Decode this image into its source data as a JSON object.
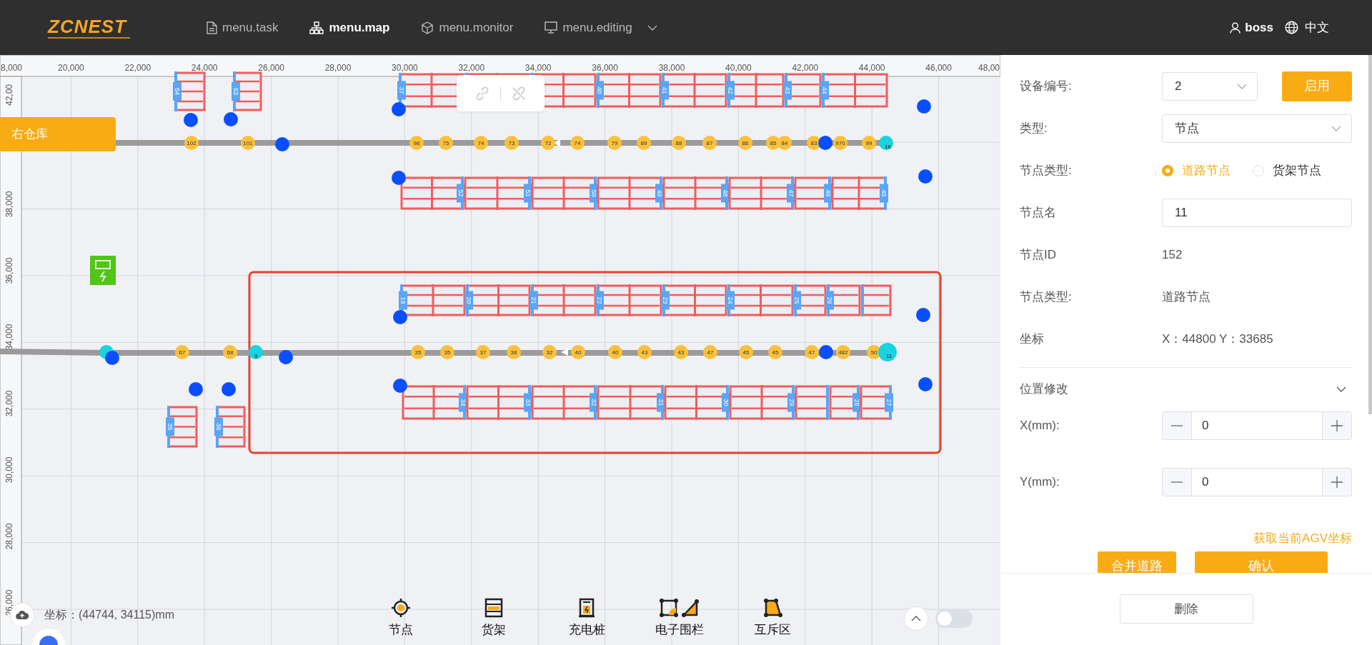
{
  "header": {
    "logo": "ZCNEST",
    "menu": [
      {
        "label": "menu.task",
        "selected": false,
        "dropdown": false
      },
      {
        "label": "menu.map",
        "selected": true,
        "dropdown": false
      },
      {
        "label": "menu.monitor",
        "selected": false,
        "dropdown": false
      },
      {
        "label": "menu.editing",
        "selected": false,
        "dropdown": true
      }
    ],
    "user": "boss",
    "language": "中文"
  },
  "map": {
    "x_ruler": [
      "8,000",
      "20,000",
      "22,000",
      "24,000",
      "26,000",
      "28,000",
      "30,000",
      "32,000",
      "34,000",
      "36,000",
      "38,000",
      "40,000",
      "42,000",
      "44,000",
      "46,000",
      "48,00"
    ],
    "y_ruler": [
      "42,00",
      "38,000",
      "36,000",
      "34,000",
      "32,000",
      "30,000",
      "28,000",
      "26,000"
    ],
    "area_label": "右仓库",
    "racks": [
      {
        "segments": [
          {
            "kind": "tagged",
            "label": "37"
          },
          {
            "kind": "plain"
          },
          {
            "kind": "plain"
          },
          {
            "kind": "tagged",
            "label": "40"
          },
          {
            "kind": "tagged",
            "label": "41"
          },
          {
            "kind": "tagged",
            "label": "42"
          },
          {
            "kind": "tagged",
            "label": "43"
          },
          {
            "kind": "tagged",
            "label": "44"
          }
        ]
      },
      {
        "segments": [
          {
            "kind": "tagged",
            "label": "52"
          },
          {
            "kind": "tagged",
            "label": "51"
          },
          {
            "kind": "tagged",
            "label": "50"
          },
          {
            "kind": "tagged",
            "label": "49"
          },
          {
            "kind": "tagged",
            "label": "48"
          },
          {
            "kind": "tagged",
            "label": "47"
          },
          {
            "kind": "tagged",
            "label": "46"
          },
          {
            "kind": "tagged",
            "label": "45"
          }
        ]
      },
      {
        "segments": [
          {
            "kind": "tagged",
            "label": "19"
          },
          {
            "kind": "tagged",
            "label": "20"
          },
          {
            "kind": "tagged",
            "label": "21"
          },
          {
            "kind": "tagged",
            "label": "22"
          },
          {
            "kind": "tagged",
            "label": "23"
          },
          {
            "kind": "tagged",
            "label": "24"
          },
          {
            "kind": "tagged",
            "label": "25"
          },
          {
            "kind": "tagged",
            "label": "26"
          },
          {
            "kind": "plain"
          }
        ]
      },
      {
        "segments": [
          {
            "kind": "tagged",
            "label": "34"
          },
          {
            "kind": "tagged",
            "label": "33"
          },
          {
            "kind": "tagged",
            "label": "32"
          },
          {
            "kind": "tagged",
            "label": "31"
          },
          {
            "kind": "tagged",
            "label": "30"
          },
          {
            "kind": "tagged",
            "label": "29"
          },
          {
            "kind": "plain"
          },
          {
            "kind": "tagged",
            "label": "28"
          },
          {
            "kind": "tagged",
            "label": "27"
          }
        ]
      },
      {
        "segments": [
          {
            "kind": "tagged",
            "label": "54"
          }
        ]
      },
      {
        "segments": [
          {
            "kind": "tagged",
            "label": "53"
          }
        ]
      },
      {
        "segments": [
          {
            "kind": "tagged",
            "label": "35"
          }
        ]
      },
      {
        "segments": [
          {
            "kind": "tagged",
            "label": "36"
          }
        ]
      }
    ],
    "roads": [
      {
        "nodes": [
          {
            "kind": "road",
            "label": "102",
            "selected": false
          },
          {
            "kind": "road",
            "label": "101",
            "selected": false
          },
          {
            "kind": "road",
            "label": "98",
            "selected": false
          },
          {
            "kind": "road",
            "label": "75",
            "selected": false
          },
          {
            "kind": "road",
            "label": "74",
            "selected": false
          },
          {
            "kind": "road",
            "label": "73",
            "selected": false
          },
          {
            "kind": "road",
            "label": "72",
            "selected": false
          },
          {
            "kind": "road",
            "label": "74",
            "selected": false
          },
          {
            "kind": "road",
            "label": "79",
            "selected": false
          },
          {
            "kind": "road",
            "label": "89",
            "selected": false
          },
          {
            "kind": "road",
            "label": "88",
            "selected": false
          },
          {
            "kind": "road",
            "label": "87",
            "selected": false
          },
          {
            "kind": "road",
            "label": "86",
            "selected": false
          },
          {
            "kind": "road",
            "label": "85",
            "selected": false
          },
          {
            "kind": "road",
            "label": "84",
            "selected": false
          },
          {
            "kind": "road",
            "label": "83",
            "selected": false
          },
          {
            "kind": "road",
            "label": "970",
            "selected": false
          },
          {
            "kind": "road",
            "label": "99",
            "selected": false
          },
          {
            "kind": "anchor",
            "label": "16",
            "selected": false
          }
        ]
      },
      {
        "nodes": [
          {
            "kind": "anchor",
            "selected": false
          },
          {
            "kind": "road",
            "label": "67",
            "selected": false
          },
          {
            "kind": "road",
            "label": "68",
            "selected": false
          },
          {
            "kind": "anchor",
            "label": "9",
            "selected": false
          },
          {
            "kind": "road",
            "label": "35",
            "selected": false
          },
          {
            "kind": "road",
            "label": "35",
            "selected": false
          },
          {
            "kind": "road",
            "label": "37",
            "selected": false
          },
          {
            "kind": "road",
            "label": "38",
            "selected": false
          },
          {
            "kind": "road",
            "label": "32",
            "selected": false
          },
          {
            "kind": "road",
            "label": "40",
            "selected": false
          },
          {
            "kind": "road",
            "label": "40",
            "selected": false
          },
          {
            "kind": "road",
            "label": "43",
            "selected": false
          },
          {
            "kind": "road",
            "label": "43",
            "selected": false
          },
          {
            "kind": "road",
            "label": "47",
            "selected": false
          },
          {
            "kind": "road",
            "label": "45",
            "selected": false
          },
          {
            "kind": "road",
            "label": "45",
            "selected": false
          },
          {
            "kind": "road",
            "label": "47",
            "selected": false
          },
          {
            "kind": "road",
            "label": "482",
            "selected": false
          },
          {
            "kind": "road",
            "label": "50",
            "selected": false
          },
          {
            "kind": "anchor",
            "label": "11",
            "selected": true
          }
        ]
      }
    ],
    "coordinates": "坐标：(44744, 34115)mm",
    "tools": [
      {
        "kind": "node",
        "label": "节点"
      },
      {
        "kind": "shelf",
        "label": "货架"
      },
      {
        "kind": "charger",
        "label": "充电桩"
      },
      {
        "kind": "fence",
        "label": "电子围栏"
      },
      {
        "kind": "mutex",
        "label": "互斥区"
      }
    ],
    "toggle": {
      "on": false
    }
  },
  "panel": {
    "fields": [
      {
        "kind": "select",
        "label": "设备编号:",
        "value": "2",
        "button": "启用"
      },
      {
        "kind": "select",
        "label": "类型:",
        "value": "节点"
      },
      {
        "kind": "radio",
        "label": "节点类型:",
        "options": [
          {
            "label": "道路节点",
            "selected": true
          },
          {
            "label": "货架节点",
            "selected": false
          }
        ]
      },
      {
        "kind": "input",
        "label": "节点名",
        "value": "11"
      },
      {
        "kind": "text",
        "label": "节点ID",
        "value": "152"
      },
      {
        "kind": "text",
        "label": "节点类型:",
        "value": "道路节点"
      },
      {
        "kind": "text",
        "label": "坐标",
        "value": "X：44800 Y：33685"
      }
    ],
    "position_edit": {
      "title": "位置修改",
      "expanded": true,
      "fields": [
        {
          "label": "X(mm):",
          "value": "0"
        },
        {
          "label": "Y(mm):",
          "value": "0"
        }
      ],
      "link": "获取当前AGV坐标",
      "buttons": [
        "合并道路",
        "确认"
      ]
    },
    "footer_button": "删除"
  }
}
